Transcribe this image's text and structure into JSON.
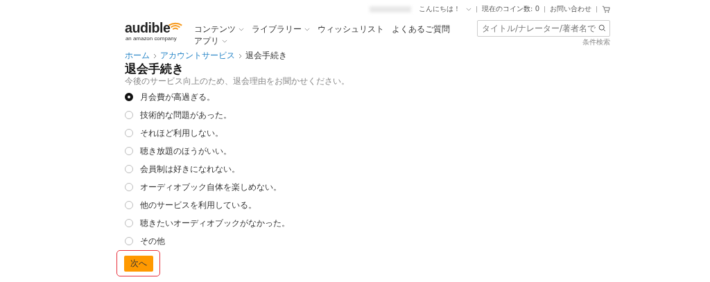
{
  "top_bar": {
    "greeting": "こんにちは！",
    "coins": "現在のコイン数: 0",
    "contact": "お問い合わせ"
  },
  "logo": {
    "wordmark": "audible",
    "tagline": "an amazon company"
  },
  "nav": [
    {
      "label": "コンテンツ",
      "dropdown": true
    },
    {
      "label": "ライブラリー",
      "dropdown": true
    },
    {
      "label": "ウィッシュリスト",
      "dropdown": false
    },
    {
      "label": "よくあるご質問",
      "dropdown": false
    },
    {
      "label": "アプリ",
      "dropdown": true
    }
  ],
  "search": {
    "placeholder": "タイトル/ナレーター/著者名で",
    "advanced_link": "条件検索"
  },
  "breadcrumb": [
    {
      "label": "ホーム",
      "kind": "link"
    },
    {
      "label": "アカウントサービス",
      "kind": "link"
    },
    {
      "label": "退会手続き",
      "kind": "current"
    }
  ],
  "title": "退会手続き",
  "subtitle": "今後のサービス向上のため、退会理由をお聞かせください。",
  "reasons": [
    {
      "label": "月会費が高過ぎる。",
      "selected": true
    },
    {
      "label": "技術的な問題があった。",
      "selected": false
    },
    {
      "label": "それほど利用しない。",
      "selected": false
    },
    {
      "label": "聴き放題のほうがいい。",
      "selected": false
    },
    {
      "label": "会員制は好きになれない。",
      "selected": false
    },
    {
      "label": "オーディオブック自体を楽しめない。",
      "selected": false
    },
    {
      "label": "他のサービスを利用している。",
      "selected": false
    },
    {
      "label": "聴きたいオーディオブックがなかった。",
      "selected": false
    },
    {
      "label": "その他",
      "selected": false
    }
  ],
  "next_button": {
    "label": "次へ",
    "highlighted": true
  }
}
